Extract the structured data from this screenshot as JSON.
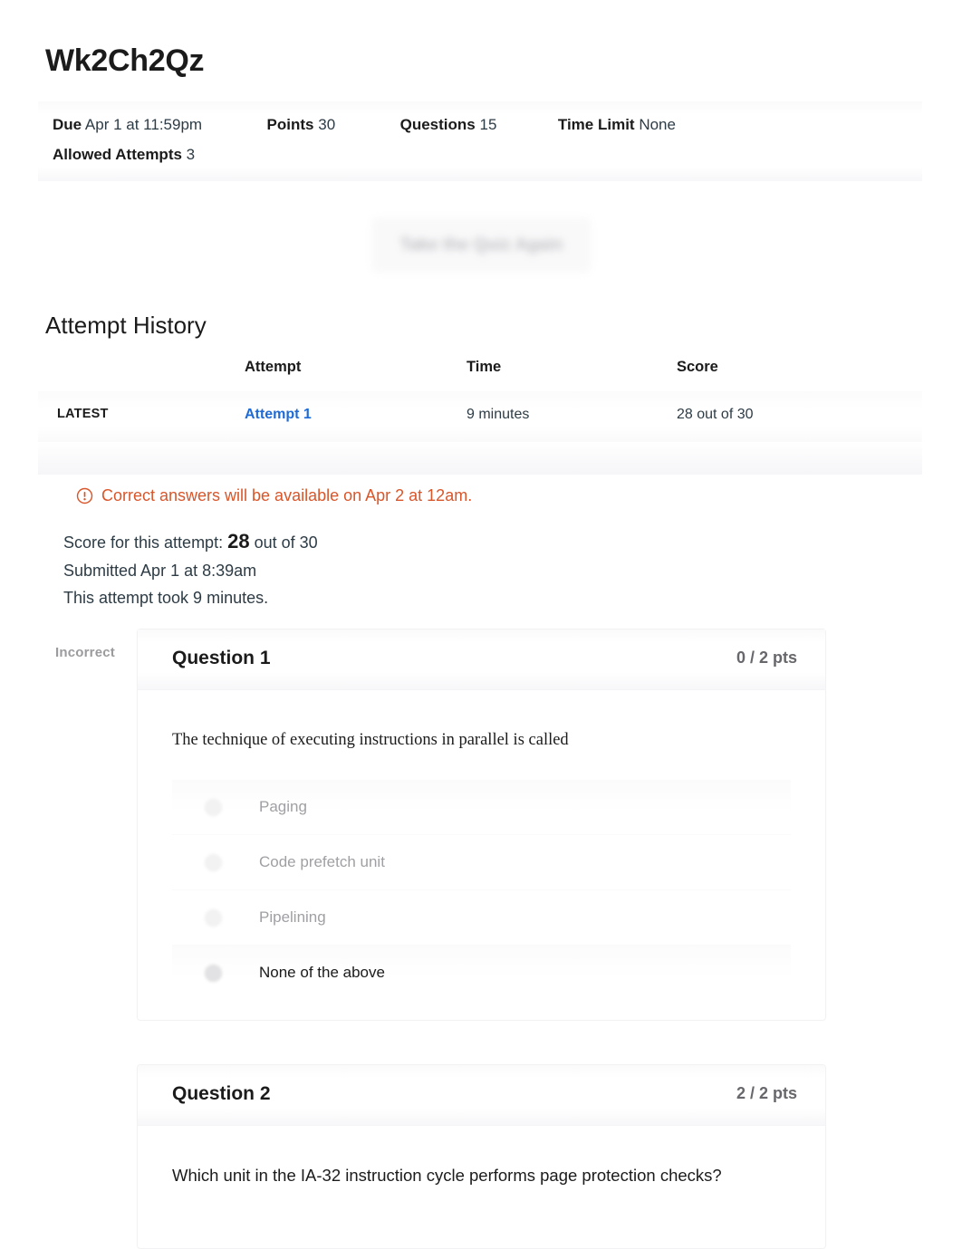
{
  "quiz": {
    "title": "Wk2Ch2Qz",
    "details": [
      {
        "key": "Due",
        "value": "Apr 1 at 11:59pm"
      },
      {
        "key": "Points",
        "value": "30"
      },
      {
        "key": "Questions",
        "value": "15"
      },
      {
        "key": "Time Limit",
        "value": "None"
      },
      {
        "key": "Allowed Attempts",
        "value": "3"
      }
    ]
  },
  "actions": {
    "take_again_label": "Take the Quiz Again"
  },
  "attempt_history": {
    "heading": "Attempt History",
    "columns": [
      "",
      "Attempt",
      "Time",
      "Score"
    ],
    "rows": [
      {
        "label": "LATEST",
        "attempt": "Attempt 1",
        "time": "9 minutes",
        "score": "28 out of 30"
      }
    ]
  },
  "notice": {
    "icon": "exclamation-circle-icon",
    "text": "Correct answers will be available on Apr 2 at 12am.",
    "color": "#d8562a"
  },
  "summary": {
    "score_prefix": "Score for this attempt:",
    "score_value": "28",
    "score_suffix": "out of 30",
    "submitted": "Submitted Apr 1 at 8:39am",
    "duration": "This attempt took 9 minutes."
  },
  "questions": [
    {
      "status": "Incorrect",
      "name": "Question 1",
      "points": "0 / 2 pts",
      "text": "The technique of executing instructions in parallel is called",
      "font": "serif",
      "answers": [
        {
          "label": "Paging",
          "selected": false
        },
        {
          "label": "Code prefetch unit",
          "selected": false
        },
        {
          "label": "Pipelining",
          "selected": false
        },
        {
          "label": "None of the above",
          "selected": true
        }
      ]
    },
    {
      "status": "",
      "name": "Question 2",
      "points": "2 / 2 pts",
      "text": "Which unit in the IA-32 instruction cycle performs page protection checks?",
      "font": "sans",
      "answers": []
    }
  ]
}
